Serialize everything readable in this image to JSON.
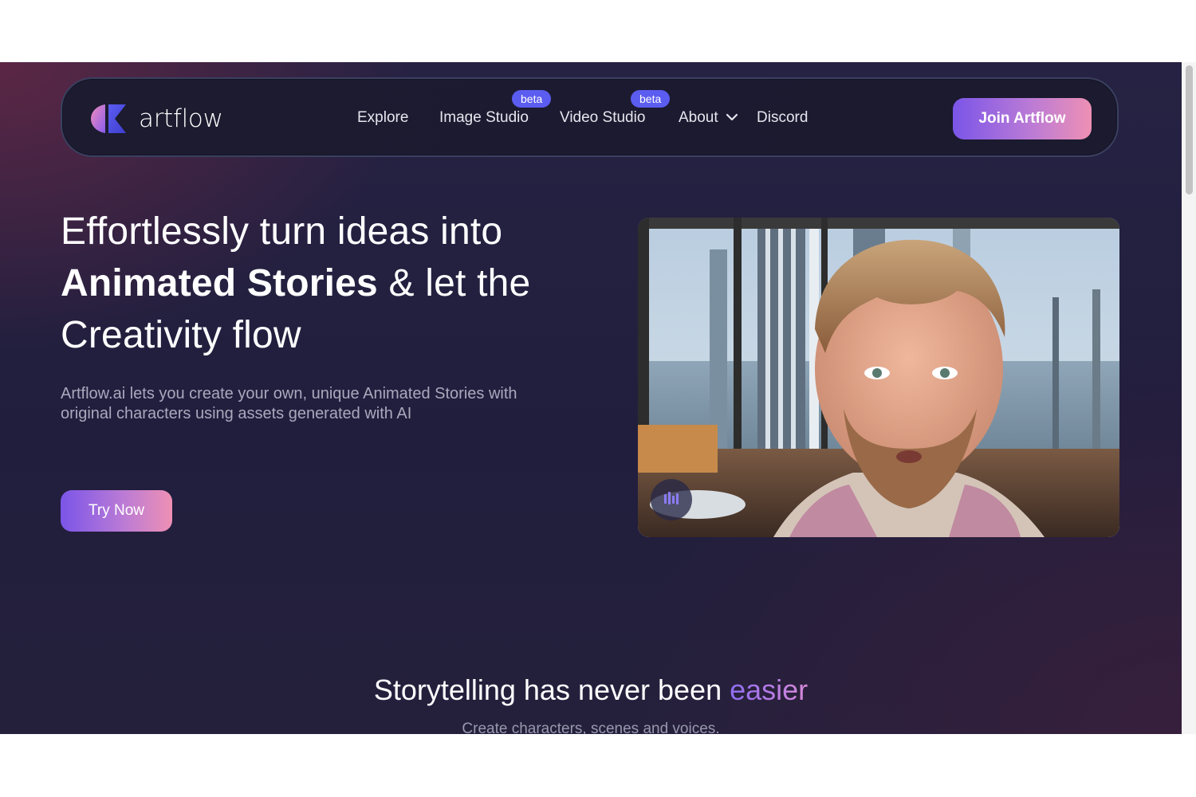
{
  "brand": {
    "name": "artflow",
    "gradient_colors": [
      "#7b55e8",
      "#b97ad6",
      "#ee90b4"
    ]
  },
  "nav": {
    "items": [
      {
        "label": "Explore"
      },
      {
        "label": "Image Studio",
        "badge": "beta"
      },
      {
        "label": "Video Studio",
        "badge": "beta"
      },
      {
        "label": "About",
        "icon": "chevron-down-icon"
      },
      {
        "label": "Discord"
      }
    ],
    "cta_label": "Join Artflow"
  },
  "hero": {
    "title_line1": "Effortlessly turn ideas into",
    "title_bold": "Animated Stories",
    "title_after_bold": " & let the",
    "title_line3": "Creativity flow",
    "description": "Artflow.ai lets you create your own, unique Animated Stories with original characters using assets generated with AI",
    "cta_label": "Try Now",
    "video_control_icon": "audio-wave-icon"
  },
  "section": {
    "title_prefix": "Storytelling has never been ",
    "title_accent": "easier",
    "subtitle": "Create characters, scenes and voices."
  }
}
